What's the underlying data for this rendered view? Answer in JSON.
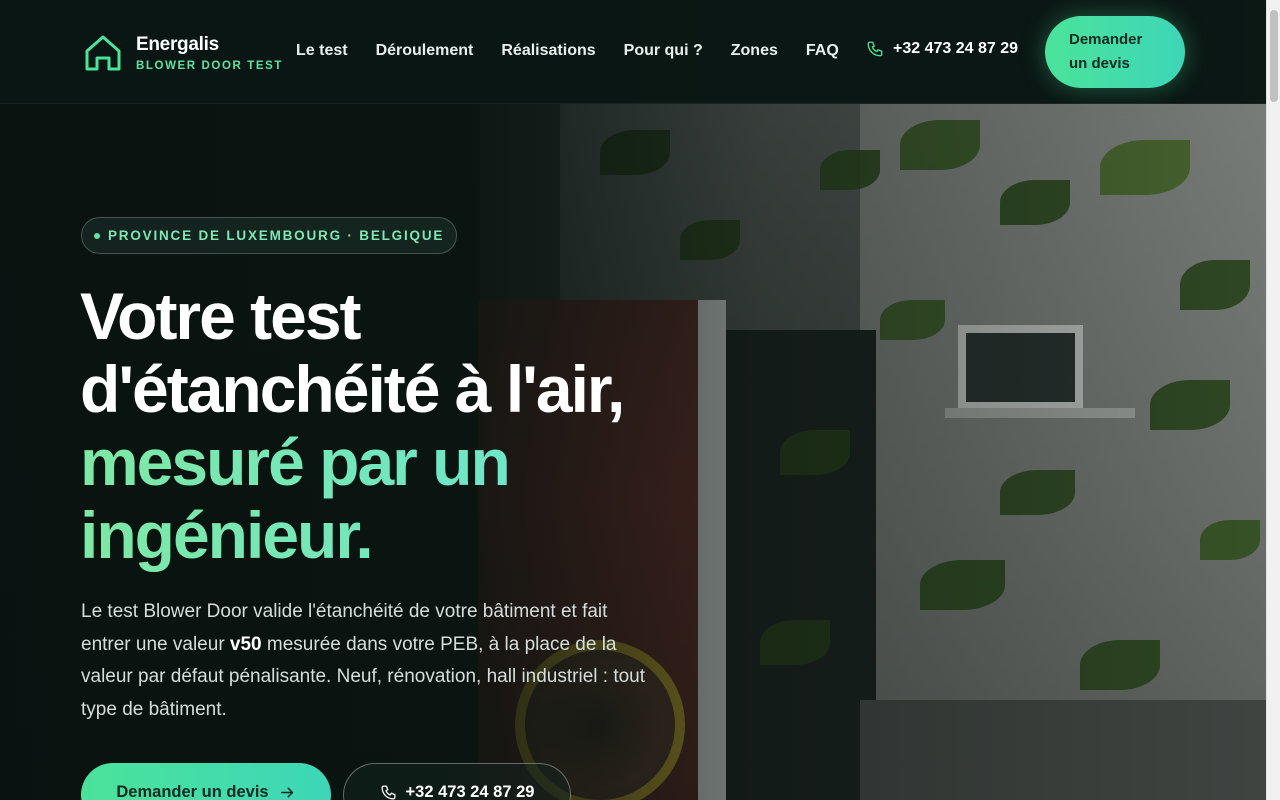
{
  "brand": {
    "name": "Energalis",
    "tagline": "BLOWER DOOR TEST",
    "accent_color": "#4be39a",
    "icon": "house-outline-icon"
  },
  "nav": {
    "items": [
      {
        "label": "Le test"
      },
      {
        "label": "Déroulement"
      },
      {
        "label": "Réalisations"
      },
      {
        "label": "Pour qui ?"
      },
      {
        "label": "Zones"
      },
      {
        "label": "FAQ"
      }
    ],
    "phone": "+32 473 24 87 29",
    "phone_icon": "phone-icon",
    "cta_label": "Demander un devis"
  },
  "hero": {
    "badge": "PROVINCE DE LUXEMBOURG · BELGIQUE",
    "headline_white_1": "Votre test",
    "headline_white_2": "d'étanchéité à l'air,",
    "headline_green_1": "mesuré par un",
    "headline_green_2": "ingénieur.",
    "lead_before": "Le test Blower Door valide l'étanchéité de votre bâtiment et fait entrer une valeur ",
    "lead_bold": "v50",
    "lead_after": " mesurée dans votre PEB, à la place de la valeur par défaut pénalisante. Neuf, rénovation, hall industriel : tout type de bâtiment.",
    "primary_cta": "Demander un devis",
    "primary_cta_icon": "arrow-right-icon",
    "secondary_cta": "+32 473 24 87 29",
    "secondary_cta_icon": "phone-icon"
  }
}
